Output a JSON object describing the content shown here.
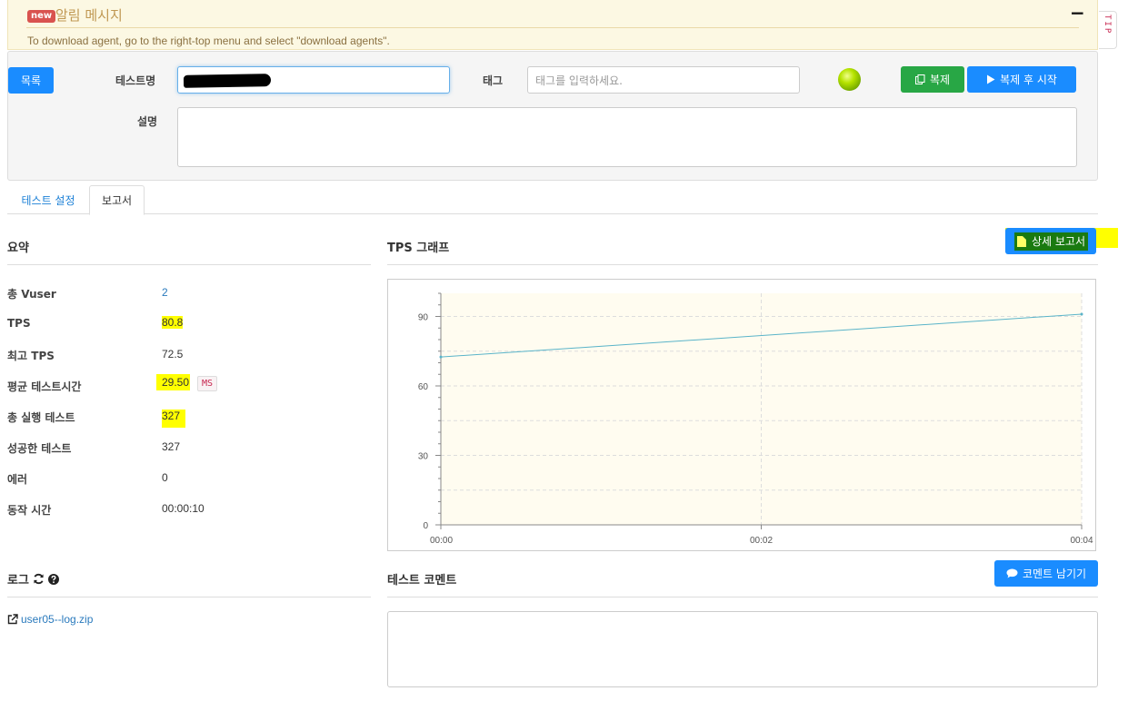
{
  "alert": {
    "badge": "new",
    "title": "알림 메시지",
    "collapse_symbol": "−",
    "message": "To download agent, go to the right-top menu and select \"download agents\".",
    "tip_label": "TIP"
  },
  "header": {
    "list_button": "목록",
    "test_name_label": "테스트명",
    "test_name_value": "",
    "tag_label": "태그",
    "tag_placeholder": "태그를 입력하세요.",
    "status_color": "#9ad000",
    "copy_button": "복제",
    "copy_start_button": "복제 후 시작",
    "description_label": "설명",
    "description_value": ""
  },
  "tabs": [
    {
      "label": "테스트 설정",
      "active": false
    },
    {
      "label": "보고서",
      "active": true
    }
  ],
  "summary": {
    "title": "요약",
    "rows": [
      {
        "label": "총 Vuser",
        "value": "2"
      },
      {
        "label": "TPS",
        "value": "80.8"
      },
      {
        "label": "최고 TPS",
        "value": "72.5"
      },
      {
        "label": "평균 테스트시간",
        "value": "29.50",
        "unit": "MS"
      },
      {
        "label": "총 실행 테스트",
        "value": "327"
      },
      {
        "label": "성공한 테스트",
        "value": "327"
      },
      {
        "label": "에러",
        "value": "0"
      },
      {
        "label": "동작 시간",
        "value": "00:00:10"
      }
    ]
  },
  "tps_graph": {
    "title": "TPS 그래프",
    "detail_button": "상세 보고서"
  },
  "chart_data": {
    "type": "line",
    "title": "",
    "xlabel": "",
    "ylabel": "",
    "x": [
      "00:00",
      "00:04"
    ],
    "series": [
      {
        "values": [
          72.5,
          91
        ]
      }
    ],
    "x_ticks": [
      "00:00",
      "00:02",
      "00:04"
    ],
    "y_ticks": [
      0,
      30,
      60,
      90
    ],
    "ylim": [
      0,
      100
    ],
    "grid": true,
    "line_color": "#5ab4c9",
    "plot_background": "#fffcf0"
  },
  "log": {
    "title": "로그",
    "file": "user05--log.zip"
  },
  "comment": {
    "title": "테스트 코멘트",
    "button": "코멘트 남기기",
    "value": ""
  },
  "colors": {
    "primary": "#1a8cff",
    "success": "#28a745",
    "highlight": "#ffff00",
    "alert_bg": "#fcf8e3"
  }
}
